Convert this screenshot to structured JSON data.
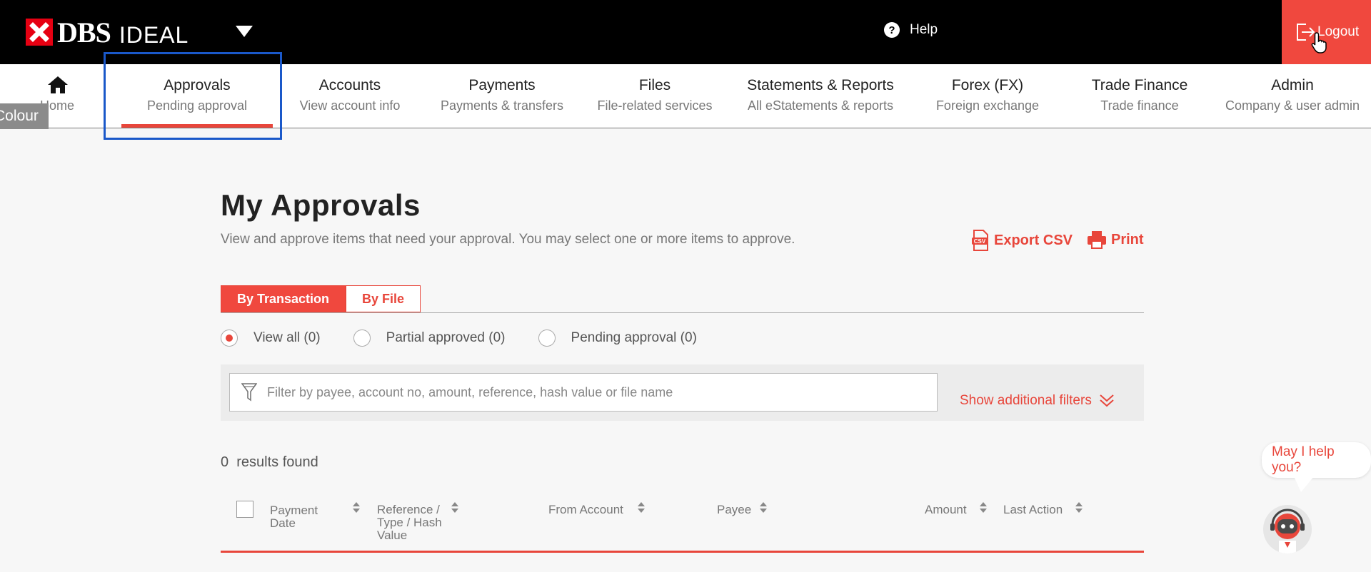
{
  "header": {
    "brand": "DBS",
    "product": "IDEAL",
    "help_label": "Help",
    "logout_label": "Logout"
  },
  "nav": {
    "home_label": "Home",
    "items": [
      {
        "title": "Approvals",
        "sub": "Pending approval"
      },
      {
        "title": "Accounts",
        "sub": "View account info"
      },
      {
        "title": "Payments",
        "sub": "Payments & transfers"
      },
      {
        "title": "Files",
        "sub": "File-related services"
      },
      {
        "title": "Statements & Reports",
        "sub": "All eStatements & reports"
      },
      {
        "title": "Forex (FX)",
        "sub": "Foreign exchange"
      },
      {
        "title": "Trade Finance",
        "sub": "Trade finance"
      },
      {
        "title": "Admin",
        "sub": "Company & user admin"
      }
    ],
    "active_index": 0
  },
  "colour_tag": "Colour",
  "page": {
    "title": "My Approvals",
    "description": "View and approve items that need your approval. You may select one or more items to approve.",
    "export_label": "Export CSV",
    "print_label": "Print"
  },
  "tabs": [
    {
      "label": "By Transaction",
      "active": true
    },
    {
      "label": "By File",
      "active": false
    }
  ],
  "radios": [
    {
      "label": "View all (0)",
      "checked": true
    },
    {
      "label": "Partial approved (0)",
      "checked": false
    },
    {
      "label": "Pending approval (0)",
      "checked": false
    }
  ],
  "filter": {
    "placeholder": "Filter by payee, account no, amount, reference, hash value or file name",
    "value": "",
    "more_label": "Show additional filters"
  },
  "results": {
    "count": "0",
    "label": "results found"
  },
  "table": {
    "columns": [
      "Payment Date",
      "Reference / Type / Hash Value",
      "From Account",
      "Payee",
      "Amount",
      "Last Action"
    ]
  },
  "assistant": {
    "bubble_text": "May I help you?"
  },
  "colors": {
    "accent": "#f0483e",
    "highlight_box": "#1a58c9",
    "topbar": "#000000"
  },
  "icons": [
    "dbs-logo-icon",
    "caret-down-icon",
    "help-icon",
    "logout-icon",
    "hand-cursor-icon",
    "home-icon",
    "csv-icon",
    "printer-icon",
    "filter-funnel-icon",
    "double-chevron-down-icon",
    "sort-icon",
    "chatbot-avatar-icon"
  ]
}
